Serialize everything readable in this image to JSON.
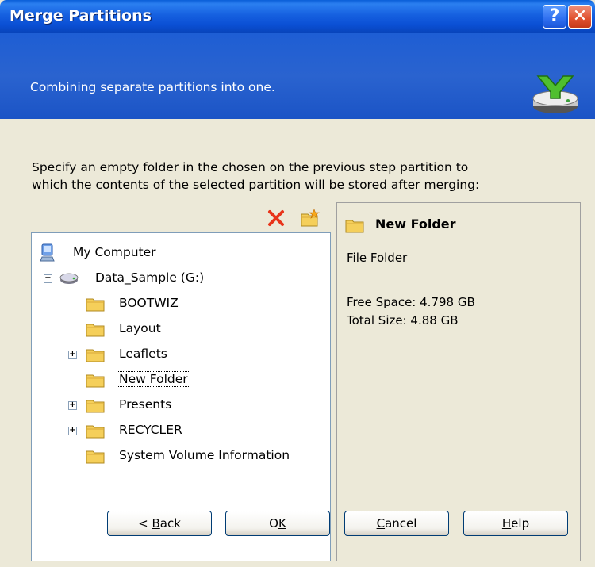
{
  "window": {
    "title": "Merge Partitions",
    "help_glyph": "?",
    "close_glyph": "✕"
  },
  "header": {
    "subtitle": "Combining separate partitions into one.",
    "icon": "merge-disk-icon"
  },
  "instructions": {
    "line1": "Specify an empty folder in the chosen on the previous step partition to",
    "line2": "which the contents of the selected partition will be stored after merging:"
  },
  "toolbar": {
    "delete_icon": "delete-icon",
    "new_folder_icon": "new-folder-icon"
  },
  "tree": {
    "root": "My Computer",
    "drive": "Data_Sample (G:)",
    "items": [
      {
        "label": "BOOTWIZ",
        "expandable": false
      },
      {
        "label": "Layout",
        "expandable": false
      },
      {
        "label": "Leaflets",
        "expandable": true
      },
      {
        "label": "New Folder",
        "expandable": false,
        "selected": true
      },
      {
        "label": "Presents",
        "expandable": true
      },
      {
        "label": "RECYCLER",
        "expandable": true
      },
      {
        "label": "System Volume Information",
        "expandable": false
      }
    ]
  },
  "properties": {
    "name": "New Folder",
    "type": "File Folder",
    "free_space": "Free Space: 4.798 GB",
    "total_size": "Total Size: 4.88 GB"
  },
  "buttons": {
    "back_prefix": "< ",
    "back_accel": "B",
    "back_rest": "ack",
    "ok_first": "O",
    "ok_accel": "K",
    "cancel_accel": "C",
    "cancel_rest": "ancel",
    "help_accel": "H",
    "help_rest": "elp"
  },
  "colors": {
    "titlebar": "#0a4fd4",
    "header": "#2a63cf",
    "dialog_bg": "#ece9d8",
    "delete_red": "#e8341a",
    "folder_yellow": "#f5cf5a"
  }
}
